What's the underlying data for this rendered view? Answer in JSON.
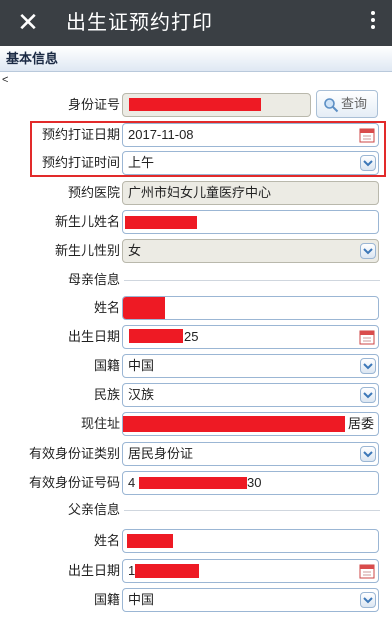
{
  "topbar": {
    "close_glyph": "✕",
    "title": "出生证预约打印",
    "more_icon": "vertical-ellipsis"
  },
  "section": {
    "title": "基本信息",
    "back_glyph": "<"
  },
  "form": {
    "id_label": "身份证号",
    "id_value": "",
    "query_button": "查询",
    "date_label": "预约打证日期",
    "date_value": "2017-11-08",
    "time_label": "预约打证时间",
    "time_value": "上午",
    "hospital_label": "预约医院",
    "hospital_value": "广州市妇女儿童医疗中心",
    "baby_name_label": "新生儿姓名",
    "baby_name_value": "",
    "baby_gender_label": "新生儿性别",
    "baby_gender_value": "女"
  },
  "mother": {
    "heading": "母亲信息",
    "name_label": "姓名",
    "name_value": "",
    "birth_label": "出生日期",
    "birth_value": "25",
    "nationality_label": "国籍",
    "nationality_value": "中国",
    "ethnicity_label": "民族",
    "ethnicity_value": "汉族",
    "address_label": "现住址",
    "address_value": "居委",
    "id_type_label": "有效身份证类别",
    "id_type_value": "居民身份证",
    "id_no_label": "有效身份证号码",
    "id_no_prefix": "4",
    "id_no_suffix": "30"
  },
  "father": {
    "heading": "父亲信息",
    "name_label": "姓名",
    "name_value": "",
    "birth_label": "出生日期",
    "birth_value": "1",
    "nationality_label": "国籍",
    "nationality_value": "中国"
  },
  "colors": {
    "topbar": "#3a3f44",
    "accent_border": "#9bb6d4",
    "redaction": "#ee1a24",
    "highlight": "#e22a2a"
  }
}
